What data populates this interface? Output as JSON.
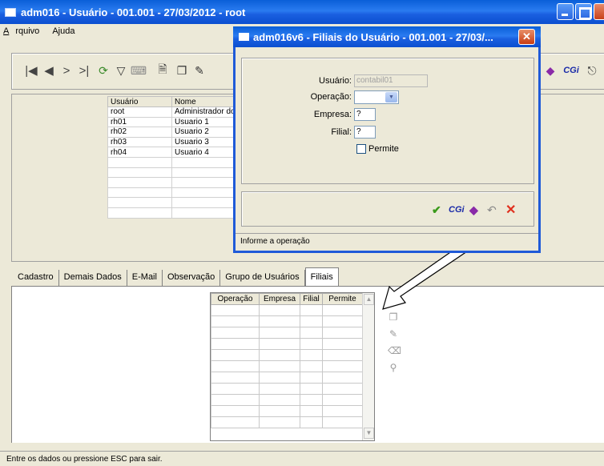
{
  "window": {
    "title": "adm016 - Usuário - 001.001 - 27/03/2012 - root"
  },
  "menu": {
    "items": [
      {
        "label_first": "A",
        "label_rest": "rquivo"
      },
      {
        "label_first": "",
        "label_rest": "Ajuda"
      }
    ]
  },
  "toolbar": {
    "first_icon": "first-record-icon",
    "prev_icon": "previous-record-icon",
    "next_icon": "next-record-icon",
    "last_icon": "last-record-icon",
    "right_label": "CGi"
  },
  "users_table": {
    "headers": [
      "Usuário",
      "Nome"
    ],
    "rows": [
      [
        "root",
        "Administrador do"
      ],
      [
        "rh01",
        "Usuario 1"
      ],
      [
        "rh02",
        "Usuario 2"
      ],
      [
        "rh03",
        "Usuario 3"
      ],
      [
        "rh04",
        "Usuario 4"
      ]
    ]
  },
  "tabs": [
    "Cadastro",
    "Demais Dados",
    "E-Mail",
    "Observação",
    "Grupo de Usuários",
    "Filiais"
  ],
  "active_tab": "Filiais",
  "filiais_table": {
    "headers": [
      "Operação",
      "Empresa",
      "Filial",
      "Permite"
    ]
  },
  "status": "Entre os dados ou pressione ESC para sair.",
  "dialog": {
    "title": "adm016v6 - Filiais do Usuário - 001.001 - 27/03/...",
    "usuario_label": "Usuário:",
    "usuario_value": "contabil01",
    "operacao_label": "Operação:",
    "operacao_value": "",
    "empresa_label": "Empresa:",
    "empresa_value": "?",
    "filial_label": "Filial:",
    "filial_value": "?",
    "permite_label": "Permite",
    "permite_checked": false,
    "cgi_label": "CGi",
    "status": "Informe a operação"
  },
  "colors": {
    "title_blue": "#0a5fd8",
    "confirm_green": "#3a9a1a",
    "cancel_red": "#e0301e",
    "cgi_blue": "#1a2aa8"
  }
}
